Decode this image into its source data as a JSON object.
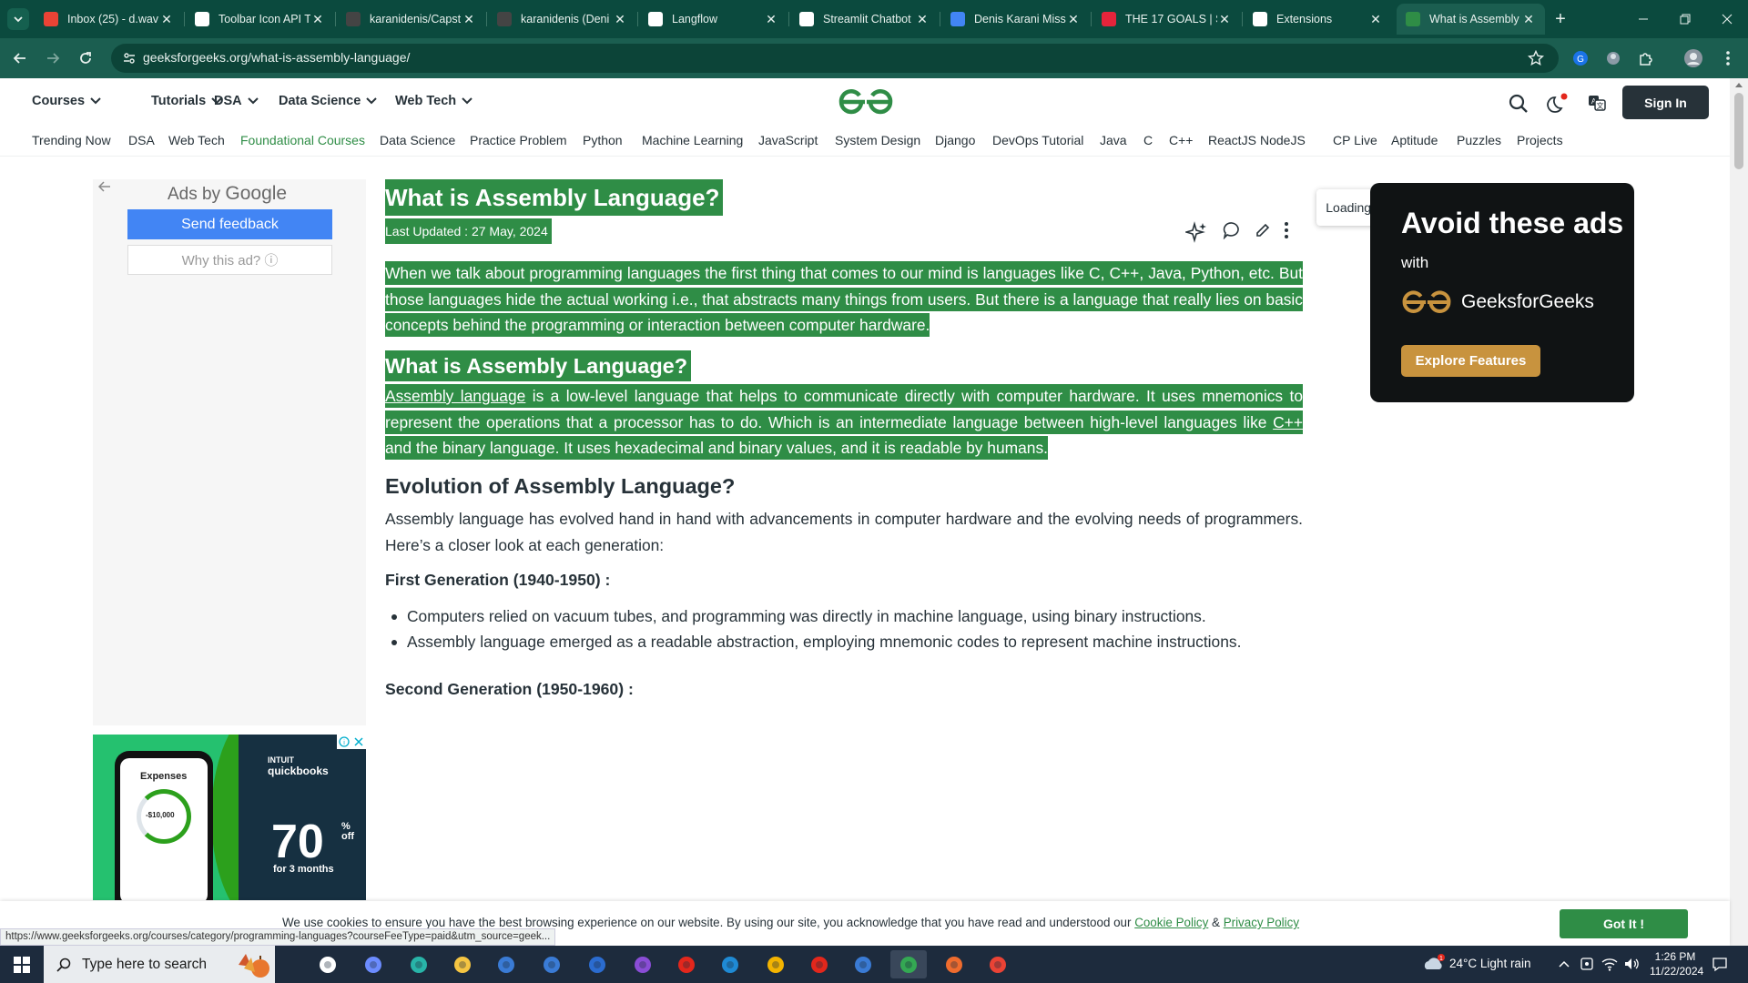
{
  "browser": {
    "tabs": [
      {
        "title": "Inbox (25) - d.wav",
        "icon": "gmail-icon",
        "color": "#ea4335"
      },
      {
        "title": "Toolbar Icon API T",
        "icon": "openai-icon",
        "color": "#ffffff"
      },
      {
        "title": "karanidenis/Capst",
        "icon": "github-icon",
        "color": "#444444"
      },
      {
        "title": "karanidenis (Deni",
        "icon": "github-icon",
        "color": "#444444"
      },
      {
        "title": "Langflow",
        "icon": "langflow-icon",
        "color": "#ffffff"
      },
      {
        "title": "Streamlit Chatbot",
        "icon": "openai-icon",
        "color": "#ffffff"
      },
      {
        "title": "Denis Karani Miss",
        "icon": "docs-icon",
        "color": "#4285f4"
      },
      {
        "title": "THE 17 GOALS | S",
        "icon": "sdg-icon",
        "color": "#e5243b"
      },
      {
        "title": "Extensions",
        "icon": "puzzle-icon",
        "color": "#ffffff"
      },
      {
        "title": "What is Assembly",
        "icon": "gfg-icon",
        "color": "#2f8d46"
      }
    ],
    "url": "geeksforgeeks.org/what-is-assembly-language/"
  },
  "header": {
    "nav": [
      "Courses",
      "Tutorials",
      "DSA",
      "Data Science",
      "Web Tech"
    ],
    "signin": "Sign In"
  },
  "subnav": [
    "Trending Now",
    "DSA",
    "Web Tech",
    "Foundational Courses",
    "Data Science",
    "Practice Problem",
    "Python",
    "Machine Learning",
    "JavaScript",
    "System Design",
    "Django",
    "DevOps Tutorial",
    "Java",
    "C",
    "C++",
    "ReactJS",
    "NodeJS",
    "CP Live",
    "Aptitude",
    "Puzzles",
    "Projects"
  ],
  "ads": {
    "ads_by": "Ads by",
    "google": "Google",
    "send_feedback": "Send feedback",
    "why_ad": "Why this ad? ⓘ",
    "qb_expenses": "Expenses",
    "qb_amount": "-$10,000",
    "qb_brand_1": "INTUIT",
    "qb_brand_2": "quickbooks",
    "qb_percent": "70",
    "qb_percent_sign": "%",
    "qb_off": "off",
    "qb_months": "for 3 months"
  },
  "article": {
    "title": "What is Assembly Language?",
    "updated": "Last Updated : 27 May, 2024",
    "intro": "When we talk about programming languages the first thing that comes to our mind is languages like C, C++, Java, Python, etc. But those languages hide the actual working i.e., that abstracts many things from users. But there is a language that really lies on basic concepts behind the programming or interaction between computer hardware.",
    "h2_what": "What is Assembly Language?",
    "p2_link": "Assembly language",
    "p2_a": " is a low-level language that helps to communicate directly with computer hardware. It uses mnemonics to represent the operations that a processor has to do. Which is an intermediate language between high-level languages like ",
    "p2_link2": "C++",
    "p2_b": " and the binary language. It uses hexadecimal and binary values, and it is readable by humans.",
    "h2_evolution": "Evolution of Assembly Language?",
    "evolution_intro": "Assembly language has evolved hand in hand with advancements in computer hardware and the evolving needs of programmers. Here’s a closer look at each generation:",
    "gen1": "First Generation (1940-1950) :",
    "gen1_points": [
      "Computers relied on vacuum tubes, and programming was directly in machine language, using binary instructions.",
      "Assembly language emerged as a readable abstraction, employing mnemonic codes to represent machine instructions."
    ],
    "gen2": "Second Generation (1950-1960) :",
    "loading": "Loading..."
  },
  "promo": {
    "headline": "Avoid these ads",
    "with": "with",
    "brand": "GeeksforGeeks",
    "button": "Explore Features"
  },
  "cookie": {
    "text_a": "We use cookies to ensure you have the best browsing experience on our website. By using our site, you acknowledge that you have read and understood our ",
    "cookie_policy": "Cookie Policy",
    "amp": " & ",
    "privacy_policy": "Privacy Policy",
    "button": "Got It !"
  },
  "status_url": "https://www.geeksforgeeks.org/courses/category/programming-languages?courseFeeType=paid&utm_source=geek...",
  "taskbar": {
    "search_placeholder": "Type here to search",
    "weather": "24°C  Light rain",
    "time": "1:26 PM",
    "date": "11/22/2024"
  },
  "colors": {
    "gfg_green": "#2f8d46",
    "chrome_dark": "#0b4a3e",
    "promo_bg": "#101314",
    "promo_button": "#c8933e"
  }
}
